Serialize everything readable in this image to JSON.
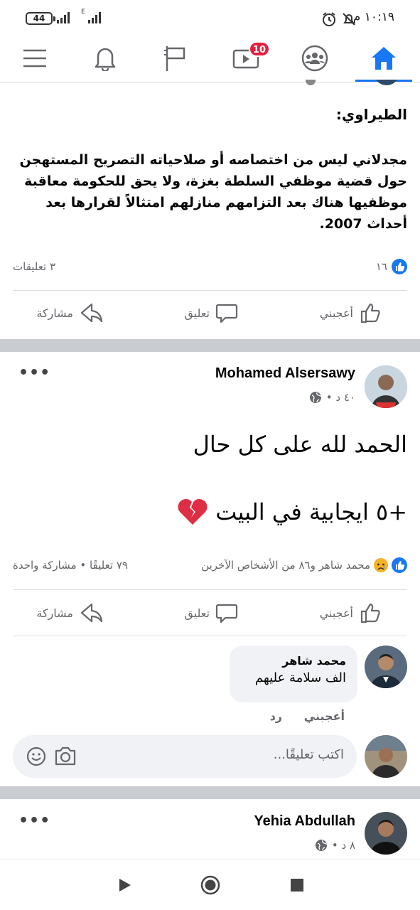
{
  "status_bar": {
    "battery": "44",
    "network": "E",
    "time": "١٠:١٩ م"
  },
  "nav": {
    "notifications_badge": "10",
    "icons": [
      "menu-icon",
      "bell-icon",
      "flag-icon",
      "video-icon",
      "groups-icon",
      "home-icon"
    ]
  },
  "post1": {
    "author_line": "الطيراوي:",
    "text": "مجدلاني ليس من اختصاصه أو صلاحياته التصريح المستهجن حول قضية موظفي السلطة بغزة، ولا يحق للحكومة معاقبة موظفيها هناك بعد التزامهم منازلهم امتثالاً لقرارها بعد أحداث 2007.",
    "likes": "١٦",
    "comments": "٣ تعليقات",
    "actions": {
      "like": "أعجبني",
      "comment": "تعليق",
      "share": "مشاركة"
    }
  },
  "post2": {
    "author": "Mohamed Alsersawy",
    "time": "٤٠ د •",
    "line1": "الحمد لله على كل حال",
    "line2": "+٥ ايجابية في البيت",
    "emoji": "💔",
    "reactions_text": "محمد شاهر و٨٦ من الأشخاص الآخرين",
    "stats": "٧٩ تعليقًا • مشاركة واحدة",
    "actions": {
      "like": "أعجبني",
      "comment": "تعليق",
      "share": "مشاركة"
    },
    "comment": {
      "author": "محمد شاهر",
      "text": "الف سلامة عليهم",
      "like": "أعجبني",
      "reply": "رد"
    },
    "write_comment_placeholder": "اكتب تعليقًا..."
  },
  "post3": {
    "author": "Yehia Abdullah",
    "time": "٨ د •"
  },
  "colors": {
    "accent": "#1877f2",
    "badge": "#e41e3f",
    "separator": "#c9ccd1",
    "muted": "#65676b"
  }
}
